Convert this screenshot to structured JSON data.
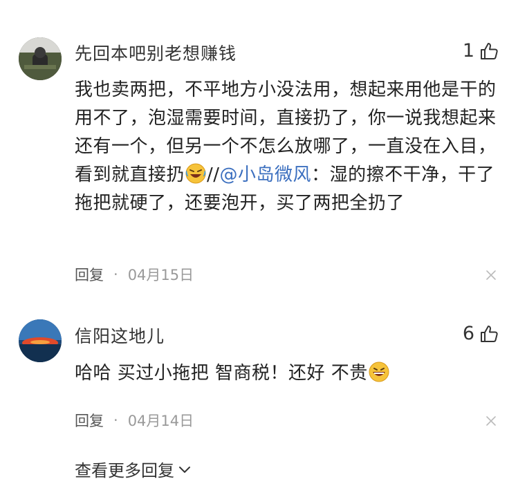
{
  "comments": [
    {
      "username": "先回本吧别老想赚钱",
      "likes": "1",
      "text_part1": "我也卖两把，不平地方小没法用，想起来用他是干的用不了，泡湿需要时间，直接扔了，你一说我想起来还有一个，但另一个不怎么放哪了，一直没在入目，看到就直接扔",
      "repost_prefix": "//",
      "mention": "@小岛微风",
      "text_part2": "：湿的擦不干净，干了拖把就硬了，还要泡开，买了两把全扔了",
      "emoji": "laughing-crying-icon",
      "reply_label": "回复",
      "separator": "·",
      "date": "04月15日"
    },
    {
      "username": "信阳这地儿",
      "likes": "6",
      "text": "哈哈 买过小拖把 智商税！还好 不贵",
      "emoji": "grinning-icon",
      "reply_label": "回复",
      "separator": "·",
      "date": "04月14日"
    }
  ],
  "more_replies_label": "查看更多回复",
  "colors": {
    "mention": "#3b6fbf",
    "meta": "#999999",
    "text": "#222222"
  }
}
